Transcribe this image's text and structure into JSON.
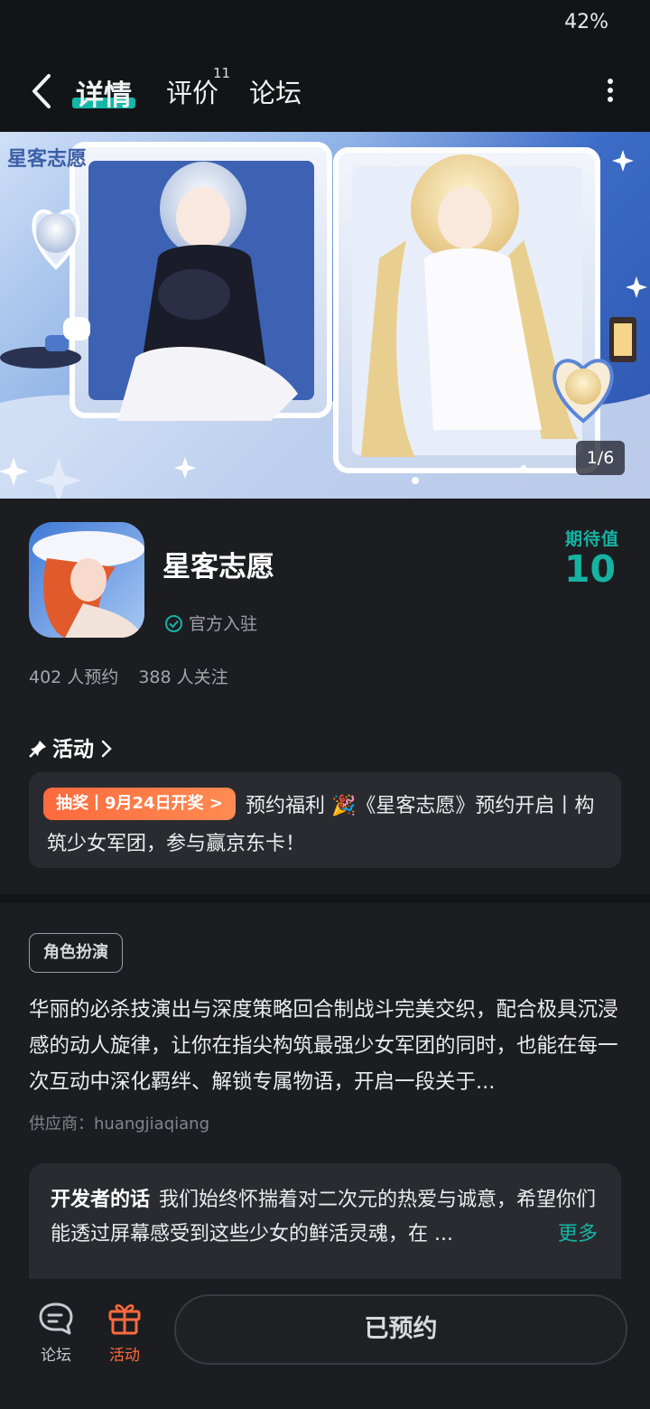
{
  "status_bar": {
    "battery": "42%"
  },
  "nav": {
    "tabs": [
      {
        "label": "详情",
        "active": true
      },
      {
        "label": "评价",
        "count": "11"
      },
      {
        "label": "论坛"
      }
    ],
    "back_icon": "chevron-left-icon",
    "more_icon": "vertical-dots-icon"
  },
  "banner": {
    "logo_text": "星客志愿",
    "counter": "1/6"
  },
  "app": {
    "name": "星客志愿",
    "official_label": "官方入驻",
    "expect_label": "期待值",
    "expect_value": "10",
    "stats": {
      "reservations": "402 人预约",
      "followers": "388 人关注"
    }
  },
  "activity": {
    "heading": "活动",
    "badge": "抽奖丨9月24日开奖 >",
    "text": "预约福利 🎉《星客志愿》预约开启丨构筑少女军团，参与赢京东卡！"
  },
  "details": {
    "genre_tag": "角色扮演",
    "description": "华丽的必杀技演出与深度策略回合制战斗完美交织，配合极具沉浸感的动人旋律，让你在指尖构筑最强少女军团的同时，也能在每一次互动中深化羁绊、解锁专属物语，开启一段关于...",
    "supplier": "供应商：huangjiaqiang"
  },
  "developer": {
    "title": "开发者的话",
    "text": "我们始终怀揣着对二次元的热爱与诚意，希望你们能透过屏幕感受到这些少女的鲜活灵魂，在 ...",
    "more_label": "更多"
  },
  "bottom_bar": {
    "forum_label": "论坛",
    "activity_label": "活动",
    "reserved_label": "已预约"
  },
  "colors": {
    "accent_teal": "#15b3a2",
    "accent_orange": "#ff6a3d",
    "background": "#1c1d21"
  }
}
